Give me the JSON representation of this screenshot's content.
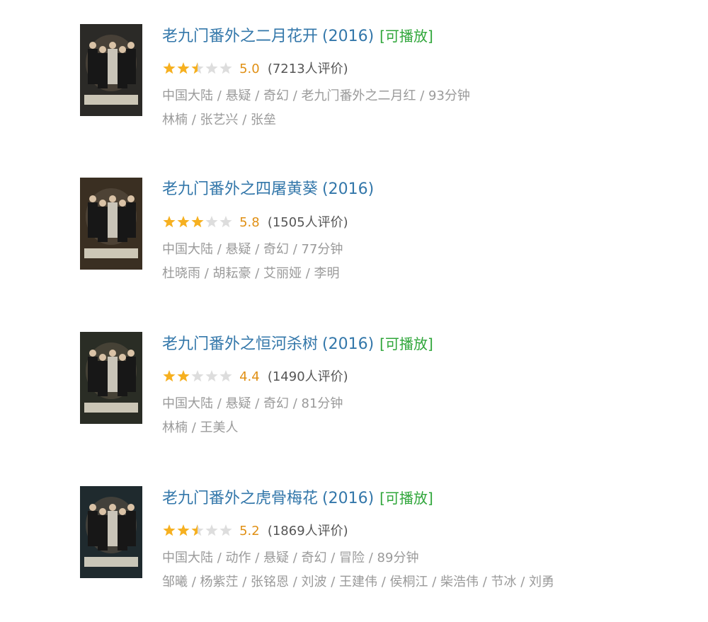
{
  "colors": {
    "title": "#3377aa",
    "playable": "#2fa63a",
    "score": "#e09015",
    "meta": "#9a9a9a",
    "star_on": "#f6b020",
    "star_off": "#dddddd"
  },
  "movies": [
    {
      "title": "老九门番外之二月花开",
      "year": "(2016)",
      "playable": "[可播放]",
      "stars": 2.5,
      "score": "5.0",
      "votes": "7213人评价",
      "meta": "中国大陆 / 悬疑 / 奇幻 / 老九门番外之二月红 / 93分钟",
      "cast": "林楠 / 张艺兴 / 张垒",
      "poster_icon": "movie-poster"
    },
    {
      "title": "老九门番外之四屠黄葵",
      "year": "(2016)",
      "playable": "",
      "stars": 3,
      "score": "5.8",
      "votes": "1505人评价",
      "meta": "中国大陆 / 悬疑 / 奇幻 / 77分钟",
      "cast": "杜晓雨 / 胡耘豪 / 艾丽娅 / 李明",
      "poster_icon": "movie-poster"
    },
    {
      "title": "老九门番外之恒河杀树",
      "year": "(2016)",
      "playable": "[可播放]",
      "stars": 2,
      "score": "4.4",
      "votes": "1490人评价",
      "meta": "中国大陆 / 悬疑 / 奇幻 / 81分钟",
      "cast": "林楠 / 王美人",
      "poster_icon": "movie-poster"
    },
    {
      "title": "老九门番外之虎骨梅花",
      "year": "(2016)",
      "playable": "[可播放]",
      "stars": 2.5,
      "score": "5.2",
      "votes": "1869人评价",
      "meta": "中国大陆 / 动作 / 悬疑 / 奇幻 / 冒险 / 89分钟",
      "cast": "邹曦 / 杨紫茳 / 张铭恩 / 刘波 / 王建伟 / 侯桐江 / 柴浩伟 / 节冰 / 刘勇",
      "poster_icon": "movie-poster"
    }
  ]
}
